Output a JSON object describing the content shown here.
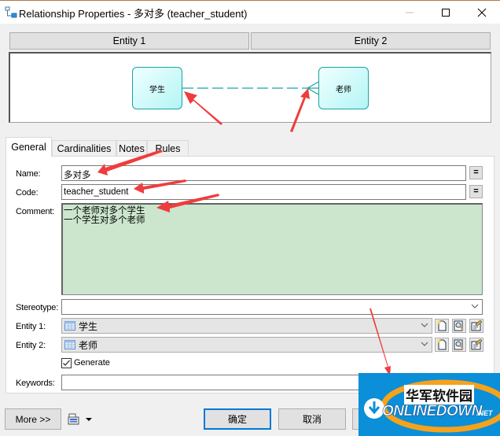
{
  "window": {
    "title": "Relationship Properties - 多对多 (teacher_student)",
    "icons": {
      "app": "relationship-icon",
      "minimize": "minimize-icon",
      "maximize": "maximize-icon",
      "close": "close-icon"
    }
  },
  "diagram": {
    "headers": [
      "Entity 1",
      "Entity 2"
    ],
    "entity1": "学生",
    "entity2": "老师",
    "line_color": "#1aa3a3",
    "entity_fill": "#c8f8f8"
  },
  "tabs": [
    {
      "label": "General",
      "active": true
    },
    {
      "label": "Cardinalities",
      "active": false
    },
    {
      "label": "Notes",
      "active": false
    },
    {
      "label": "Rules",
      "active": false
    }
  ],
  "general": {
    "name_label": "Name:",
    "name_value": "多对多",
    "code_label": "Code:",
    "code_value": "teacher_student",
    "equals_button": "=",
    "comment_label": "Comment:",
    "comment_lines": [
      "一个老师对多个学生",
      "一个学生对多个老师"
    ],
    "comment_bg": "#cbe6cd",
    "stereotype_label": "Stereotype:",
    "stereotype_value": "",
    "entity1_label": "Entity 1:",
    "entity1_value": "学生",
    "entity2_label": "Entity 2:",
    "entity2_value": "老师",
    "generate_label": "Generate",
    "generate_checked": true,
    "keywords_label": "Keywords:",
    "keywords_value": "",
    "entity_buttons": [
      "new-icon",
      "properties-icon",
      "find-icon"
    ]
  },
  "footer": {
    "more_label": "More >>",
    "ok_label": "确定",
    "cancel_label": "取消",
    "menu_icon": "print-menu-icon"
  },
  "watermark": {
    "cn_text": "华军软件园",
    "en_text": "ONLINEDOWN",
    "suffix": ".NET"
  },
  "annotation_color": "#f03c3c"
}
